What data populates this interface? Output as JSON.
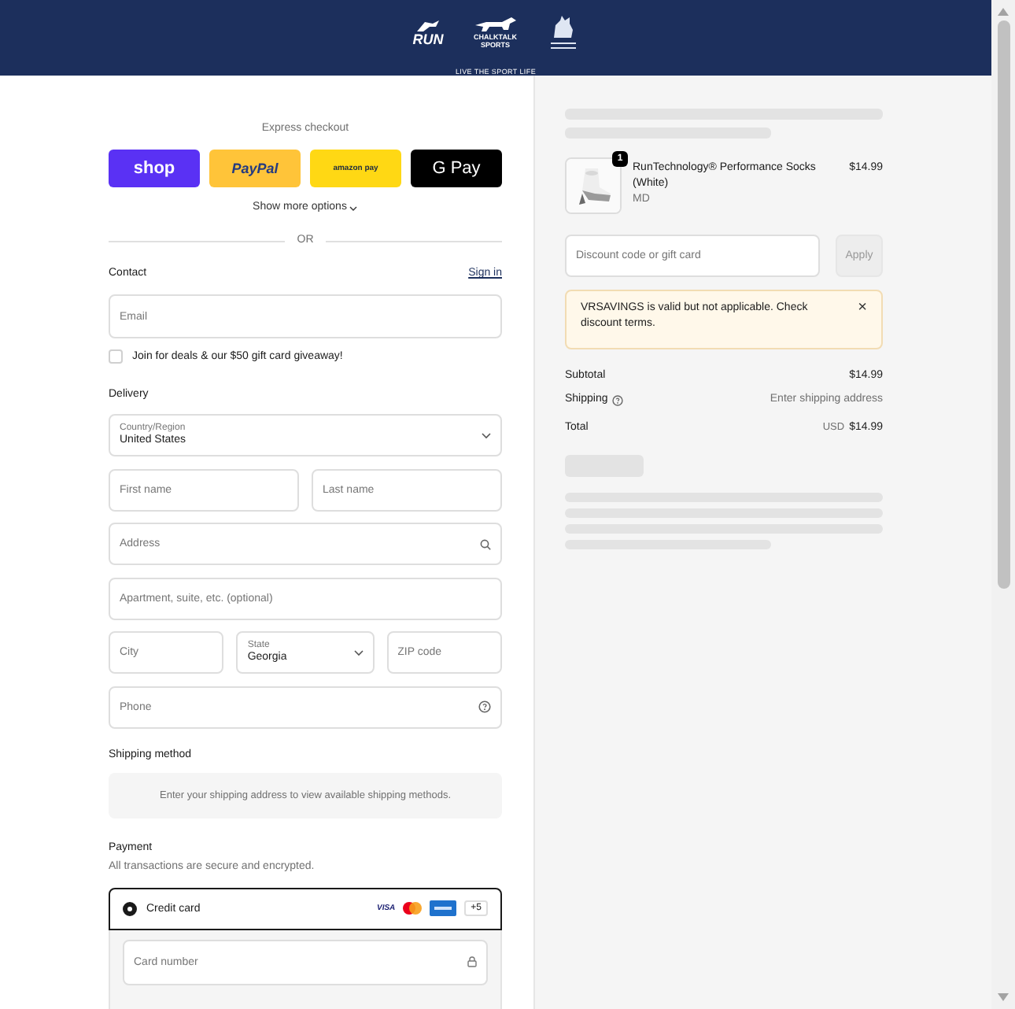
{
  "header": {
    "logos": [
      {
        "kind": "run",
        "text": "RUN"
      },
      {
        "kind": "chalktalk",
        "text": "CHALKTALK SPORTS"
      },
      {
        "kind": "mascot"
      }
    ],
    "tagline": "LIVE THE SPORT LIFE"
  },
  "express": {
    "title": "Express checkout",
    "buttons": [
      {
        "kind": "shop",
        "label": "shop"
      },
      {
        "kind": "paypal",
        "label": "PayPal"
      },
      {
        "kind": "amazon",
        "label": "amazon pay"
      },
      {
        "kind": "gpay",
        "label": "G Pay"
      }
    ],
    "more": "Show more options",
    "divider": "OR"
  },
  "contact": {
    "title": "Contact",
    "link": "Sign in",
    "email": {
      "placeholder": "Email"
    },
    "newsletter": {
      "label": "Join for deals & our $50 gift card giveaway!",
      "checked": false
    }
  },
  "delivery": {
    "title": "Delivery",
    "rows": [
      {
        "fields": [
          {
            "kind": "select",
            "label": "Country/Region",
            "value": "United States"
          }
        ]
      },
      {
        "fields": [
          {
            "kind": "input",
            "placeholder": "First name"
          },
          {
            "kind": "input",
            "placeholder": "Last name"
          }
        ]
      },
      {
        "fields": [
          {
            "kind": "search",
            "placeholder": "Address"
          }
        ]
      },
      {
        "fields": [
          {
            "kind": "input",
            "placeholder": "Apartment, suite, etc. (optional)"
          }
        ]
      },
      {
        "fields": [
          {
            "kind": "input",
            "placeholder": "City"
          },
          {
            "kind": "select",
            "label": "State",
            "value": "Georgia"
          },
          {
            "kind": "input",
            "placeholder": "ZIP code"
          }
        ]
      },
      {
        "fields": [
          {
            "kind": "help",
            "placeholder": "Phone"
          }
        ]
      }
    ]
  },
  "shipping_method": {
    "title": "Shipping method",
    "message": "Enter your shipping address to view available shipping methods."
  },
  "payment": {
    "title": "Payment",
    "subtitle": "All transactions are secure and encrypted.",
    "methods": [
      {
        "label": "Credit card",
        "selected": true,
        "cards": [
          {
            "kind": "visa",
            "text": "VISA"
          },
          {
            "kind": "mastercard"
          },
          {
            "kind": "amex"
          }
        ],
        "more": "+5"
      }
    ],
    "card_number": {
      "placeholder": "Card number"
    }
  },
  "summary": {
    "item": {
      "quantity": "1",
      "name": "RunTechnology® Performance Socks (White)",
      "variant": "MD",
      "price": "$14.99"
    },
    "discount": {
      "placeholder": "Discount code or gift card",
      "button": "Apply",
      "disabled": true
    },
    "notice": {
      "text": "VRSAVINGS is valid but not applicable. Check discount terms.",
      "close": "×"
    },
    "lines": [
      {
        "kind": "plain",
        "label": "Subtotal",
        "value": "$14.99"
      },
      {
        "kind": "help",
        "label": "Shipping",
        "value": "Enter shipping address"
      }
    ],
    "total": {
      "label": "Total",
      "currency": "USD",
      "value": "$14.99"
    }
  }
}
